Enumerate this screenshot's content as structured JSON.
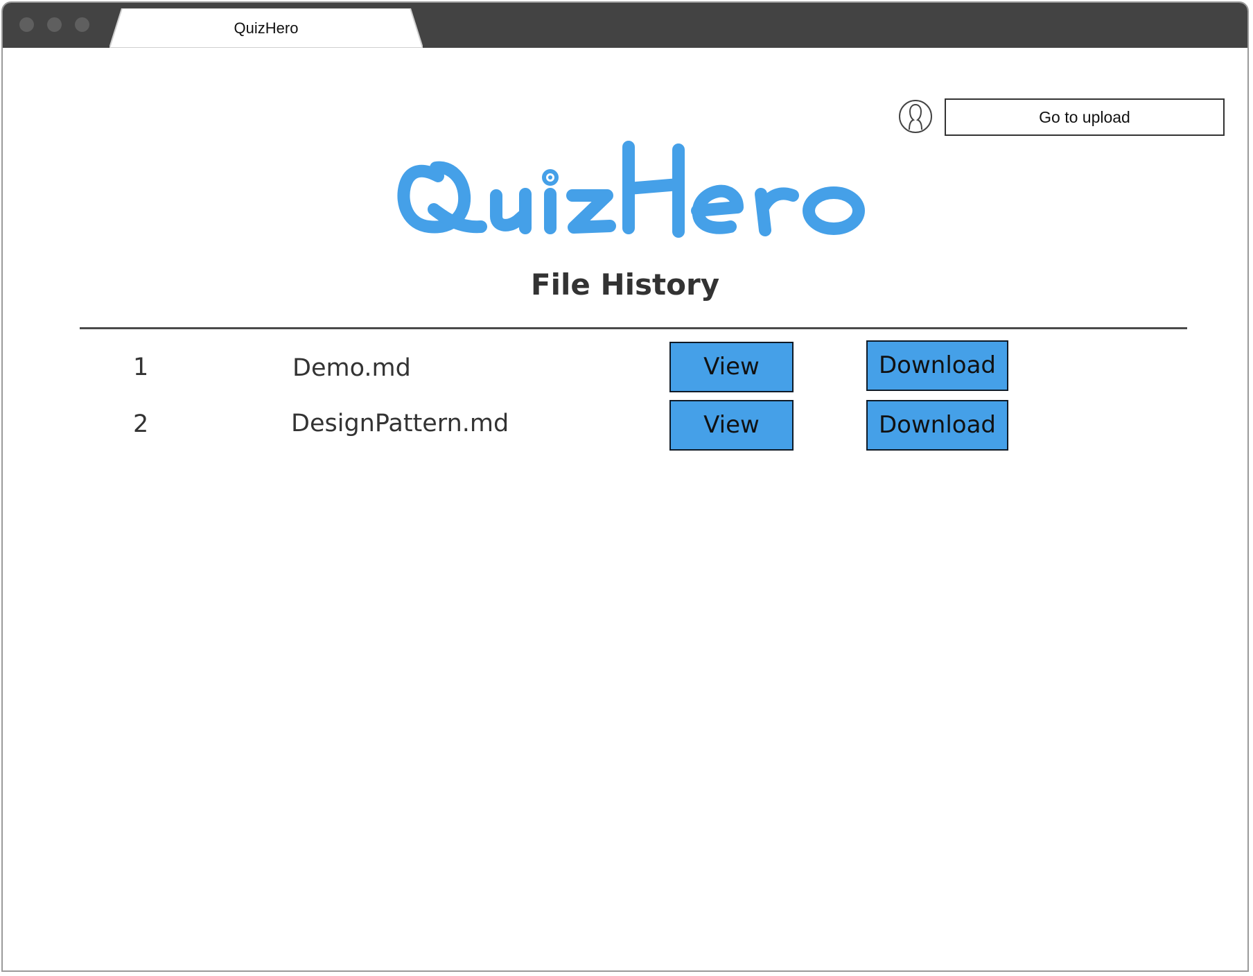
{
  "window": {
    "tab_title": "QuizHero"
  },
  "header": {
    "upload_button_label": "Go to upload",
    "avatar_icon": "user-avatar-icon"
  },
  "brand": {
    "logo_text": "QuizHero",
    "logo_color": "#45a0e8"
  },
  "main": {
    "title": "File History",
    "files": [
      {
        "index": "1",
        "name": "Demo.md",
        "view_label": "View",
        "download_label": "Download"
      },
      {
        "index": "2",
        "name": "DesignPattern.md",
        "view_label": "View",
        "download_label": "Download"
      }
    ]
  },
  "colors": {
    "chrome": "#434343",
    "button_blue": "#45a0e8",
    "text_dark": "#333333"
  }
}
